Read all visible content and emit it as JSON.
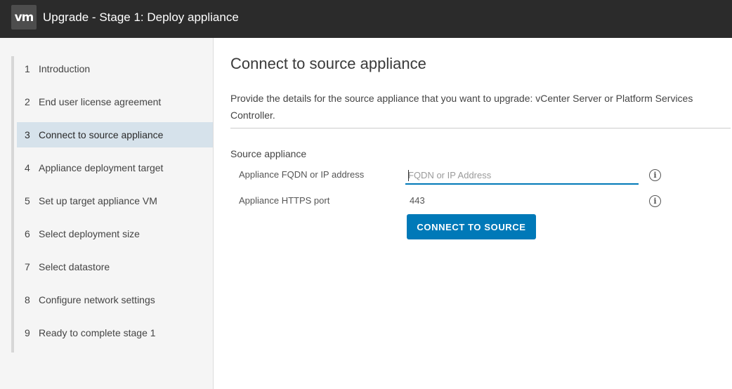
{
  "header": {
    "logo_text": "vm",
    "title": "Upgrade - Stage 1: Deploy appliance"
  },
  "sidebar": {
    "steps": [
      {
        "num": "1",
        "label": "Introduction"
      },
      {
        "num": "2",
        "label": "End user license agreement"
      },
      {
        "num": "3",
        "label": "Connect to source appliance",
        "active": true
      },
      {
        "num": "4",
        "label": "Appliance deployment target"
      },
      {
        "num": "5",
        "label": "Set up target appliance VM"
      },
      {
        "num": "6",
        "label": "Select deployment size"
      },
      {
        "num": "7",
        "label": "Select datastore"
      },
      {
        "num": "8",
        "label": "Configure network settings"
      },
      {
        "num": "9",
        "label": "Ready to complete stage 1"
      }
    ]
  },
  "main": {
    "title": "Connect to source appliance",
    "description": "Provide the details for the source appliance that you want to upgrade: vCenter Server or Platform Services Controller.",
    "section_label": "Source appliance",
    "fqdn": {
      "label": "Appliance FQDN or IP address",
      "placeholder": "FQDN or IP Address",
      "value": ""
    },
    "port": {
      "label": "Appliance HTTPS port",
      "value": "443"
    },
    "connect_button_label": "CONNECT TO SOURCE",
    "info_icon_glyph": "i"
  },
  "colors": {
    "header_bg": "#2b2b2b",
    "accent": "#0079b8",
    "active_step_bg": "#d6e2eb"
  }
}
